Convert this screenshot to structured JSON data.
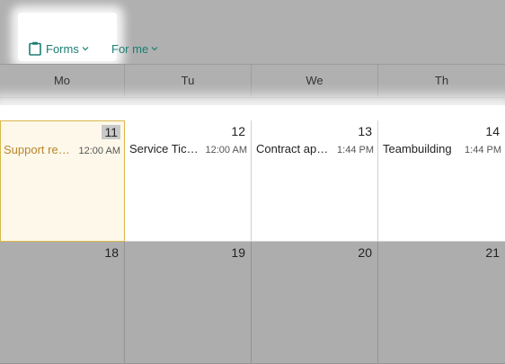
{
  "toolbar": {
    "forms_label": "Forms",
    "forms_icon": "clipboard-icon",
    "forme_label": "For me"
  },
  "weekdays": [
    "Mo",
    "Tu",
    "We",
    "Th"
  ],
  "weeks": [
    {
      "days": [
        {
          "date": "11",
          "event": {
            "title": "Support requ...",
            "time": "12:00 AM"
          }
        },
        {
          "date": "12",
          "event": {
            "title": "Service Ticket",
            "time": "12:00 AM"
          }
        },
        {
          "date": "13",
          "event": {
            "title": "Contract appr...",
            "time": "1:44 PM"
          }
        },
        {
          "date": "14",
          "event": {
            "title": "Teambuilding",
            "time": "1:44 PM"
          }
        }
      ]
    },
    {
      "days": [
        {
          "date": "18"
        },
        {
          "date": "19"
        },
        {
          "date": "20"
        },
        {
          "date": "21"
        }
      ]
    }
  ],
  "colors": {
    "accent": "#1a7f73",
    "today_event": "#b8862b",
    "today_border": "#d8b74a"
  }
}
